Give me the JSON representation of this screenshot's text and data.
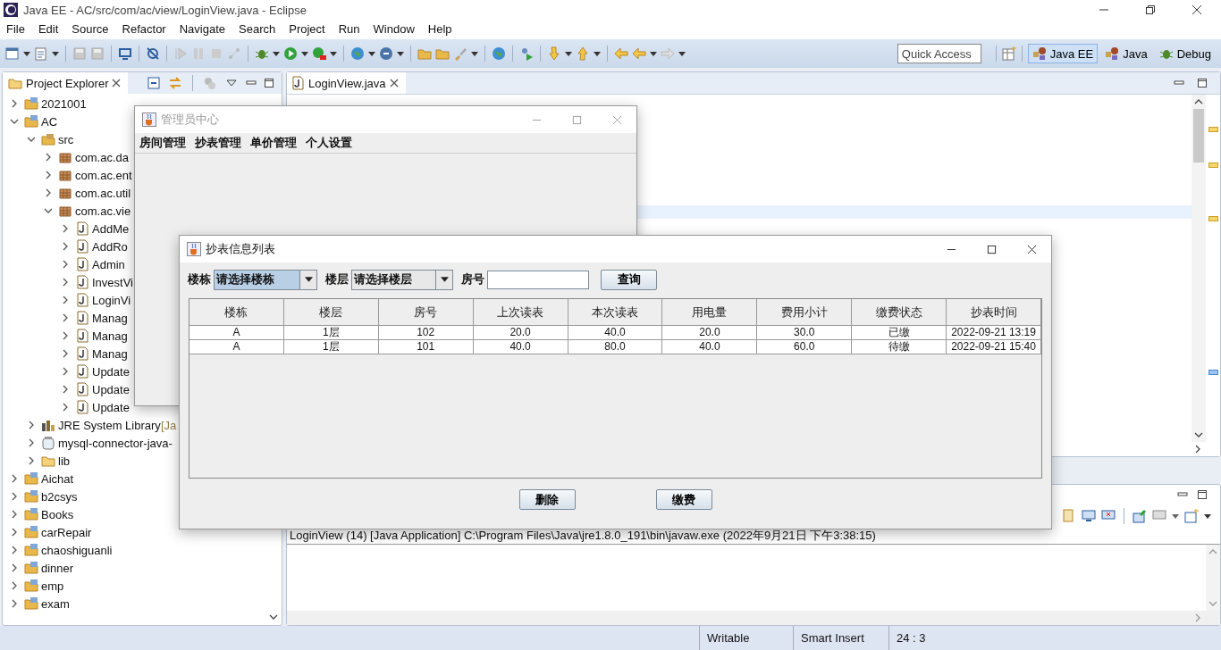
{
  "window": {
    "title": "Java EE - AC/src/com/ac/view/LoginView.java - Eclipse"
  },
  "menu": [
    "File",
    "Edit",
    "Source",
    "Refactor",
    "Navigate",
    "Search",
    "Project",
    "Run",
    "Window",
    "Help"
  ],
  "quick_access": {
    "placeholder": "Quick Access"
  },
  "perspectives": [
    {
      "label": "Java EE",
      "selected": true
    },
    {
      "label": "Java",
      "selected": false
    },
    {
      "label": "Debug",
      "selected": false
    }
  ],
  "project_explorer": {
    "title": "Project Explorer",
    "tree": [
      {
        "label": "2021001",
        "kind": "project",
        "expanded": false
      },
      {
        "label": "AC",
        "kind": "project",
        "expanded": true,
        "children": [
          {
            "label": "src",
            "kind": "source",
            "expanded": true,
            "children": [
              {
                "label": "com.ac.da",
                "kind": "package",
                "expanded": false
              },
              {
                "label": "com.ac.ent",
                "kind": "package",
                "expanded": false
              },
              {
                "label": "com.ac.util",
                "kind": "package",
                "expanded": false
              },
              {
                "label": "com.ac.vie",
                "kind": "package",
                "expanded": true,
                "children": [
                  {
                    "label": "AddMe",
                    "kind": "java",
                    "expanded": false
                  },
                  {
                    "label": "AddRo",
                    "kind": "java",
                    "expanded": false
                  },
                  {
                    "label": "Admin",
                    "kind": "java",
                    "expanded": false
                  },
                  {
                    "label": "InvestVi",
                    "kind": "java",
                    "expanded": false
                  },
                  {
                    "label": "LoginVi",
                    "kind": "java",
                    "expanded": false
                  },
                  {
                    "label": "Manag",
                    "kind": "java",
                    "expanded": false
                  },
                  {
                    "label": "Manag",
                    "kind": "java",
                    "expanded": false
                  },
                  {
                    "label": "Manag",
                    "kind": "java",
                    "expanded": false
                  },
                  {
                    "label": "Update",
                    "kind": "java",
                    "expanded": false
                  },
                  {
                    "label": "Update",
                    "kind": "java",
                    "expanded": false
                  },
                  {
                    "label": "Update",
                    "kind": "java",
                    "expanded": false
                  }
                ]
              }
            ]
          },
          {
            "label": "JRE System Library",
            "decoration": "[Ja",
            "kind": "library",
            "expanded": false
          },
          {
            "label": "mysql-connector-java-",
            "kind": "jar",
            "expanded": false
          },
          {
            "label": "lib",
            "kind": "folder",
            "expanded": false
          }
        ]
      },
      {
        "label": "Aichat",
        "kind": "project",
        "expanded": false
      },
      {
        "label": "b2csys",
        "kind": "project",
        "expanded": false
      },
      {
        "label": "Books",
        "kind": "project",
        "expanded": false
      },
      {
        "label": "carRepair",
        "kind": "project",
        "expanded": false
      },
      {
        "label": "chaoshiguanli",
        "kind": "project",
        "expanded": false
      },
      {
        "label": "dinner",
        "kind": "project",
        "expanded": false
      },
      {
        "label": "emp",
        "kind": "project",
        "expanded": false
      },
      {
        "label": "exam",
        "kind": "project",
        "expanded": false
      }
    ]
  },
  "editor": {
    "tabs": [
      {
        "label": "LoginView.java",
        "selected": true
      }
    ]
  },
  "console": {
    "text": "LoginView (14) [Java Application] C:\\Program Files\\Java\\jre1.8.0_191\\bin\\javaw.exe (2022年9月21日 下午3:38:15)"
  },
  "status_bar": [
    "Writable",
    "Smart Insert",
    "24 : 3"
  ],
  "admin_window": {
    "title": "管理员中心",
    "active": false,
    "menu": [
      "房间管理",
      "抄表管理",
      "单价管理",
      "个人设置"
    ]
  },
  "meter_dialog": {
    "title": "抄表信息列表",
    "active": true,
    "filters": {
      "building_label": "楼栋",
      "building_combo": "请选择楼栋",
      "floor_label": "楼层",
      "floor_combo": "请选择楼层",
      "room_label": "房号",
      "search_button": "查询"
    },
    "table": {
      "columns": [
        "楼栋",
        "楼层",
        "房号",
        "上次读表",
        "本次读表",
        "用电量",
        "费用小计",
        "缴费状态",
        "抄表时间"
      ],
      "rows": [
        [
          "A",
          "1层",
          "102",
          "20.0",
          "40.0",
          "20.0",
          "30.0",
          "已缴",
          "2022-09-21 13:19"
        ],
        [
          "A",
          "1层",
          "101",
          "40.0",
          "80.0",
          "40.0",
          "60.0",
          "待缴",
          "2022-09-21 15:40"
        ]
      ]
    },
    "buttons": [
      "删除",
      "缴费"
    ]
  }
}
